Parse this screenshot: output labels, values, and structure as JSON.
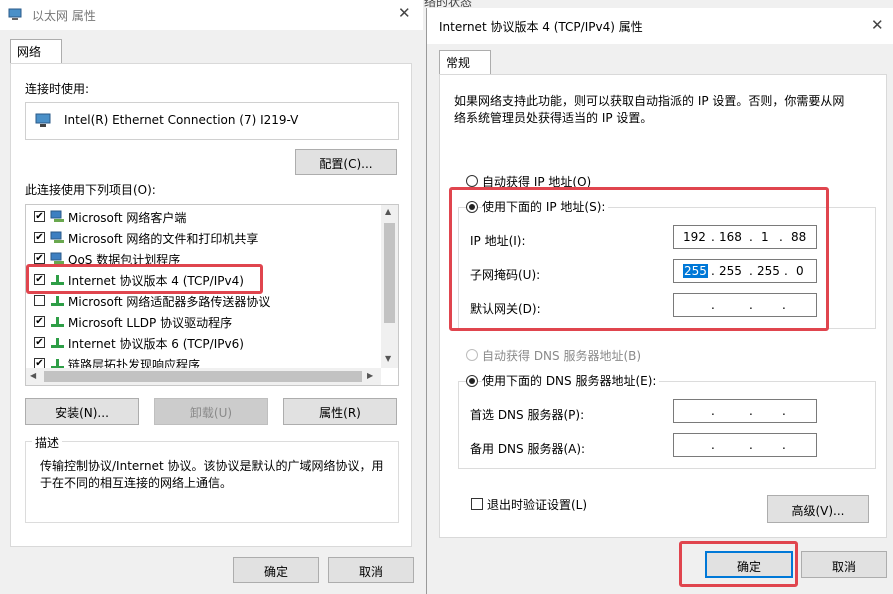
{
  "left_window": {
    "title": "以太网 属性",
    "tab": "网络",
    "connect_using_label": "连接时使用:",
    "adapter_name": "Intel(R) Ethernet Connection (7) I219-V",
    "configure_button": "配置(C)...",
    "items_label": "此连接使用下列项目(O):",
    "items": [
      {
        "label": "Microsoft 网络客户端",
        "checked": true,
        "icon": "network-client-icon"
      },
      {
        "label": "Microsoft 网络的文件和打印机共享",
        "checked": true,
        "icon": "file-sharing-icon"
      },
      {
        "label": "QoS 数据包计划程序",
        "checked": true,
        "icon": "qos-icon"
      },
      {
        "label": "Internet 协议版本 4 (TCP/IPv4)",
        "checked": true,
        "icon": "protocol-icon"
      },
      {
        "label": "Microsoft 网络适配器多路传送器协议",
        "checked": false,
        "icon": "protocol-icon"
      },
      {
        "label": "Microsoft LLDP 协议驱动程序",
        "checked": true,
        "icon": "protocol-icon"
      },
      {
        "label": "Internet 协议版本 6 (TCP/IPv6)",
        "checked": true,
        "icon": "protocol-icon"
      },
      {
        "label": "链路层拓扑发现响应程序",
        "checked": true,
        "icon": "protocol-icon"
      }
    ],
    "install_button": "安装(N)...",
    "uninstall_button": "卸载(U)",
    "properties_button": "属性(R)",
    "description_title": "描述",
    "description_text": "传输控制协议/Internet 协议。该协议是默认的广域网络协议，用于在不同的相互连接的网络上通信。",
    "ok_button": "确定",
    "cancel_button": "取消"
  },
  "right_window": {
    "title": "Internet 协议版本 4 (TCP/IPv4) 属性",
    "tab": "常规",
    "intro": "如果网络支持此功能，则可以获取自动指派的 IP 设置。否则，你需要从网络系统管理员处获得适当的 IP 设置。",
    "auto_ip_label": "自动获得 IP 地址(O)",
    "use_ip_label": "使用下面的 IP 地址(S):",
    "ip_label": "IP 地址(I):",
    "ip_value": [
      "192",
      "168",
      "1",
      "88"
    ],
    "mask_label": "子网掩码(U):",
    "mask_value": [
      "255",
      "255",
      "255",
      "0"
    ],
    "gateway_label": "默认网关(D):",
    "auto_dns_label": "自动获得 DNS 服务器地址(B)",
    "use_dns_label": "使用下面的 DNS 服务器地址(E):",
    "pref_dns_label": "首选 DNS 服务器(P):",
    "alt_dns_label": "备用 DNS 服务器(A):",
    "validate_label": "退出时验证设置(L)",
    "advanced_button": "高级(V)...",
    "ok_button": "确定",
    "cancel_button": "取消"
  },
  "top_fragment": "络的状态",
  "colors": {
    "highlight_red": "#e0454e",
    "selection_blue": "#0078d7"
  }
}
